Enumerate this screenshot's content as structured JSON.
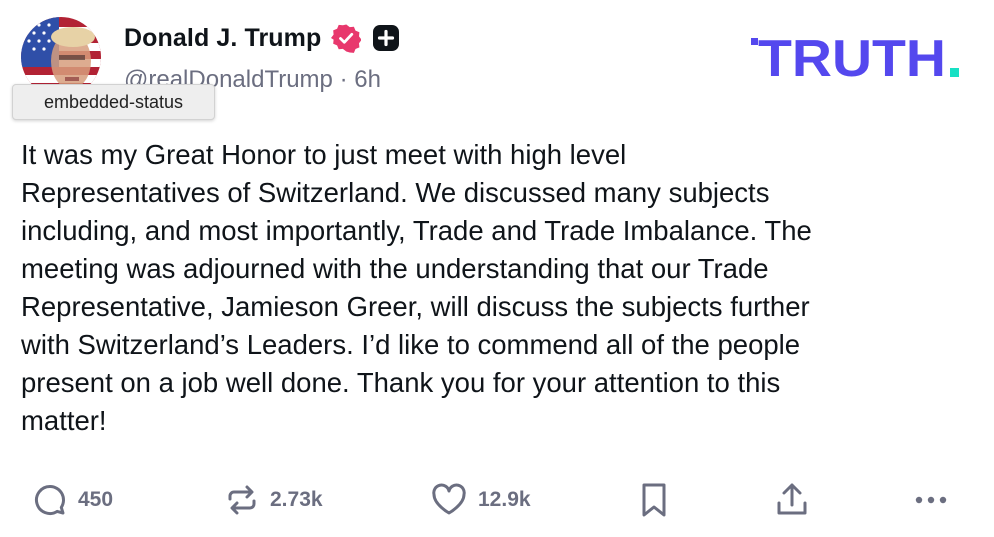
{
  "tooltip": {
    "text": "embedded-status"
  },
  "author": {
    "display_name": "Donald J. Trump",
    "handle": "@realDonaldTrump",
    "separator": "·",
    "timestamp": "6h"
  },
  "brand": {
    "logo_text": "TRUTH",
    "logo_dot": ".",
    "accent_color": "#5448ee",
    "dot_color": "#17e0c4"
  },
  "post": {
    "lines": [
      "It was my Great Honor to just meet with high level",
      "Representatives of Switzerland. We discussed many subjects",
      "including, and most importantly, Trade and Trade Imbalance. The",
      "meeting was adjourned with the understanding that our Trade",
      "Representative, Jamieson Greer, will discuss the subjects further",
      "with Switzerland’s Leaders. I’d like to commend all of the people",
      "present on a job well done. Thank you for your attention to this",
      "matter!"
    ]
  },
  "actions": {
    "replies": "450",
    "retruths": "2.73k",
    "likes": "12.9k"
  },
  "icons": {
    "reply": "comment-icon",
    "retruth": "repost-icon",
    "like": "heart-icon",
    "bookmark": "bookmark-icon",
    "share": "share-icon",
    "more": "more-icon",
    "verified": "verified-badge-icon",
    "plus": "plus-badge-icon"
  }
}
